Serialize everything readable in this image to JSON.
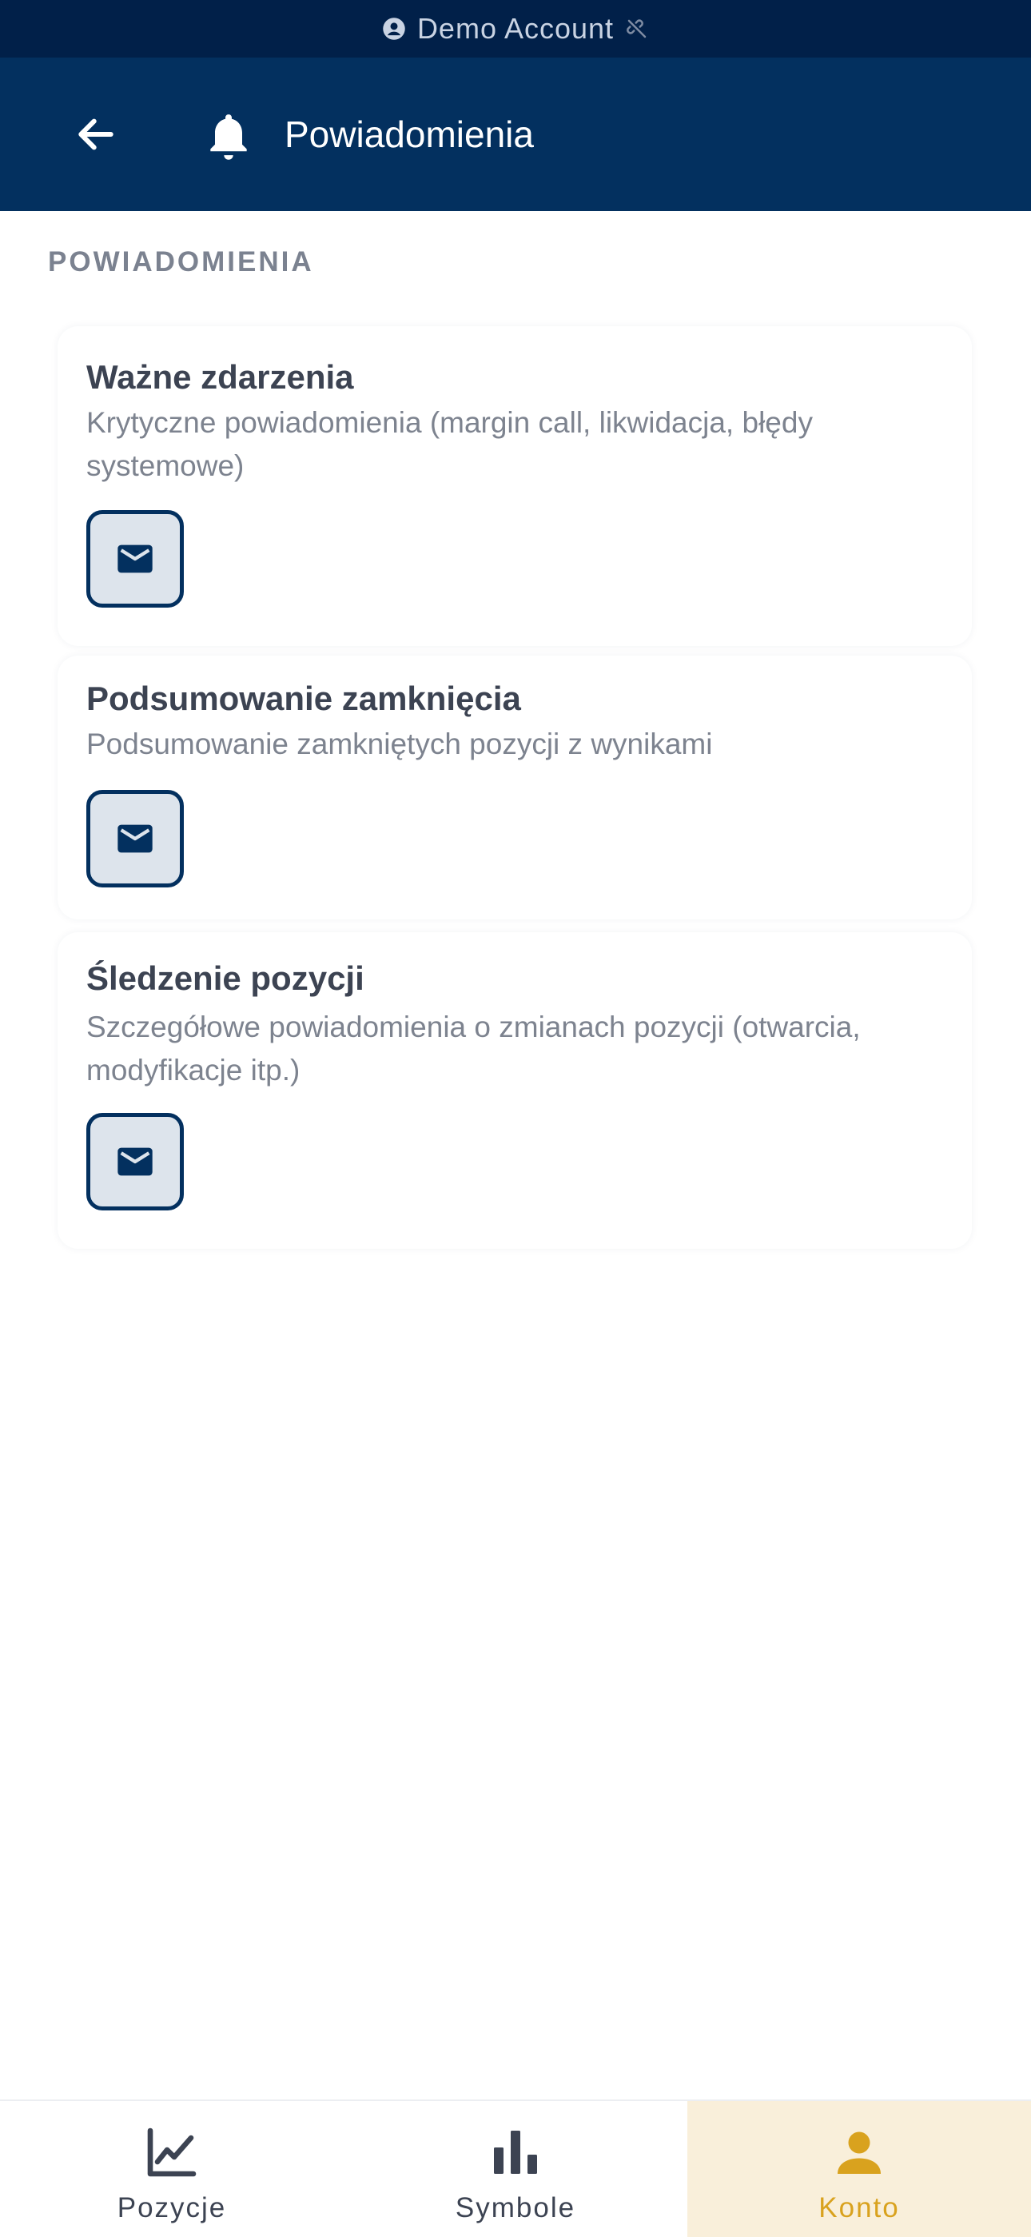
{
  "status_bar": {
    "account_label": "Demo Account",
    "account_icon": "account-circle-icon",
    "connection_icon": "link-off-icon"
  },
  "header": {
    "back_icon": "arrow-left-icon",
    "title_icon": "bell-icon",
    "title": "Powiadomienia"
  },
  "section": {
    "label": "POWIADOMIENIA"
  },
  "notifications": [
    {
      "title": "Ważne zdarzenia",
      "description": "Krytyczne powiadomienia (margin call, likwidacja, błędy systemowe)",
      "channel_icon": "email-icon",
      "email_enabled": true
    },
    {
      "title": "Podsumowanie zamknięcia",
      "description": "Podsumowanie zamkniętych pozycji z wynikami",
      "channel_icon": "email-icon",
      "email_enabled": true
    },
    {
      "title": "Śledzenie pozycji",
      "description": "Szczegółowe powiadomienia o zmianach pozycji (otwarcia, modyfikacje itp.)",
      "channel_icon": "email-icon",
      "email_enabled": true
    }
  ],
  "bottom_nav": {
    "items": [
      {
        "label": "Pozycje",
        "icon": "line-chart-icon",
        "active": false
      },
      {
        "label": "Symbole",
        "icon": "bar-chart-icon",
        "active": false
      },
      {
        "label": "Konto",
        "icon": "person-icon",
        "active": true
      }
    ]
  },
  "colors": {
    "status_bar_bg": "#012049",
    "header_bg": "#03305f",
    "accent": "#d9a21e",
    "active_nav_bg": "#f9efda",
    "toggle_bg": "#dde4ec"
  }
}
